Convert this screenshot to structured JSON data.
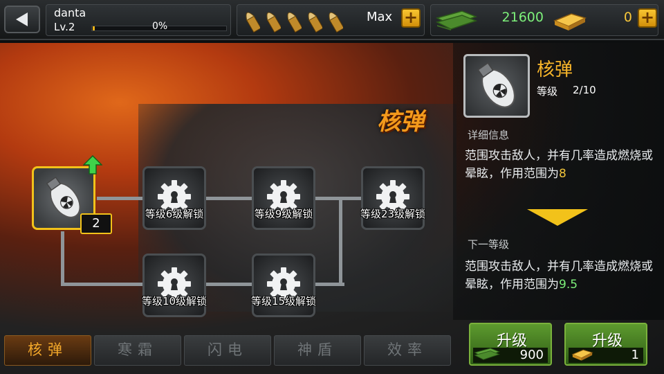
{
  "header": {
    "player_name": "danta",
    "level_label": "Lv.",
    "level_value": "2",
    "xp_percent": "0%",
    "xp_progress": 0.01,
    "ammo_count": 5,
    "ammo_label": "Max",
    "cash_value": "21600",
    "gold_value": "0"
  },
  "scene": {
    "title": "核弹"
  },
  "skill_tree": {
    "root": {
      "level": "2"
    },
    "nodes": [
      {
        "label": "等级6级解锁"
      },
      {
        "label": "等级9级解锁"
      },
      {
        "label": "等级23级解锁"
      },
      {
        "label": "等级10级解锁"
      },
      {
        "label": "等级15级解锁"
      }
    ]
  },
  "info": {
    "name": "核弹",
    "level_label": "等级",
    "level_value": "2/10",
    "detail_title": "详细信息",
    "detail_text": "范围攻击敌人，并有几率造成燃烧或晕眩，作用范围为",
    "detail_value": "8",
    "next_title": "下一等级",
    "next_text": "范围攻击敌人，并有几率造成燃烧或晕眩，作用范围为",
    "next_value": "9.5"
  },
  "tabs": [
    {
      "label": "核弹",
      "active": true
    },
    {
      "label": "寒霜",
      "active": false
    },
    {
      "label": "闪电",
      "active": false
    },
    {
      "label": "神盾",
      "active": false
    },
    {
      "label": "效率",
      "active": false
    }
  ],
  "upgrade_cash": {
    "label": "升级",
    "cost": "900"
  },
  "upgrade_gold": {
    "label": "升级",
    "cost": "1"
  },
  "colors": {
    "accent_gold": "#f2c21a",
    "cash_green": "#7df07a",
    "title_orange": "#f39a1c"
  },
  "icons": {
    "back": "back-arrow-icon",
    "bullet": "bullet-icon",
    "cash": "cash-stack-icon",
    "gold": "gold-bars-icon",
    "lock_gear": "locked-gear-icon",
    "bomb": "nuclear-bomb-icon",
    "level_up": "level-up-arrow-icon",
    "expand": "chevron-down-icon"
  }
}
